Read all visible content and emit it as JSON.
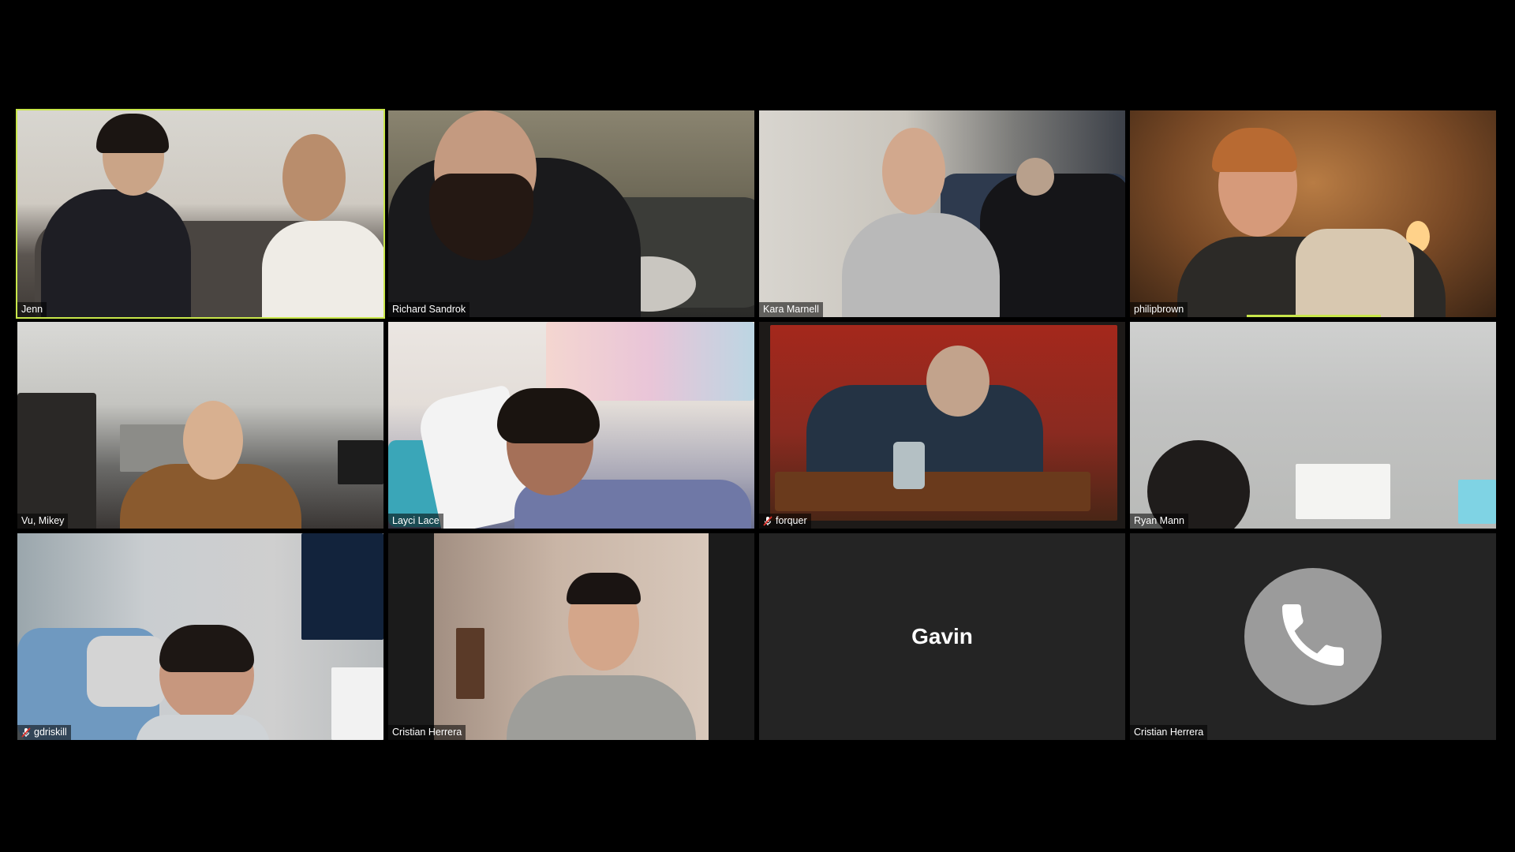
{
  "meeting": {
    "participants": [
      {
        "name": "Jenn",
        "active_speaker": true,
        "muted": false
      },
      {
        "name": "Richard Sandrok",
        "muted": false
      },
      {
        "name": "Kara Marnell",
        "muted": false
      },
      {
        "name": "philipbrown",
        "muted": false
      },
      {
        "name": "Vu, Mikey",
        "muted": false
      },
      {
        "name": "Layci Lace",
        "muted": false
      },
      {
        "name": "forquer",
        "muted": true
      },
      {
        "name": "Ryan Mann",
        "muted": false
      },
      {
        "name": "gdriskill",
        "muted": true
      },
      {
        "name": "Cristian Herrera",
        "muted": false
      },
      {
        "name": "Gavin",
        "video_off": true,
        "center_label": "Gavin"
      },
      {
        "name": "Cristian Herrera",
        "phone_only": true,
        "icon": "phone-icon"
      }
    ],
    "colors": {
      "active_border": "#c8e64a",
      "tile_background": "#242424",
      "phone_circle": "#9b9b9b"
    }
  }
}
